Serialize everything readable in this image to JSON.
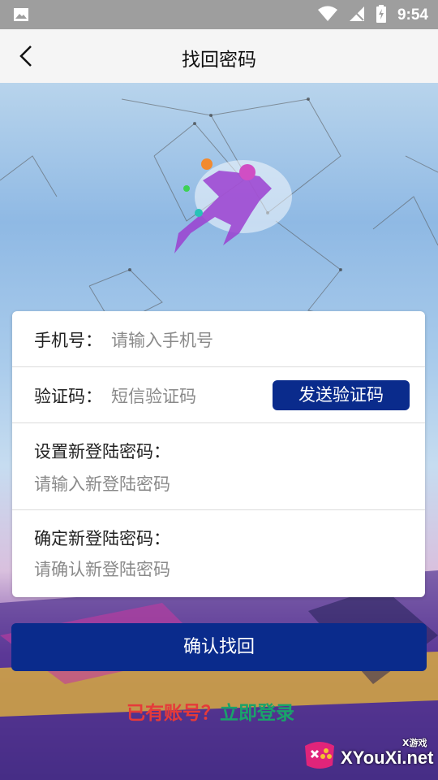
{
  "status_bar": {
    "time": "9:54"
  },
  "header": {
    "title": "找回密码"
  },
  "form": {
    "phone": {
      "label": "手机号：",
      "placeholder": "请输入手机号"
    },
    "code": {
      "label": "验证码：",
      "placeholder": "短信验证码",
      "send_button": "发送验证码"
    },
    "new_password": {
      "label": "设置新登陆密码：",
      "placeholder": "请输入新登陆密码"
    },
    "confirm_password": {
      "label": "确定新登陆密码：",
      "placeholder": "请确认新登陆密码"
    }
  },
  "confirm_button": "确认找回",
  "login_prompt": {
    "question": "已有账号？",
    "action": "立即登录"
  },
  "watermark": {
    "site": "XYouXi.net",
    "tag": "X游戏"
  },
  "colors": {
    "primary": "#0a2b8c",
    "question": "#e53a3a",
    "action": "#1aa36a"
  }
}
